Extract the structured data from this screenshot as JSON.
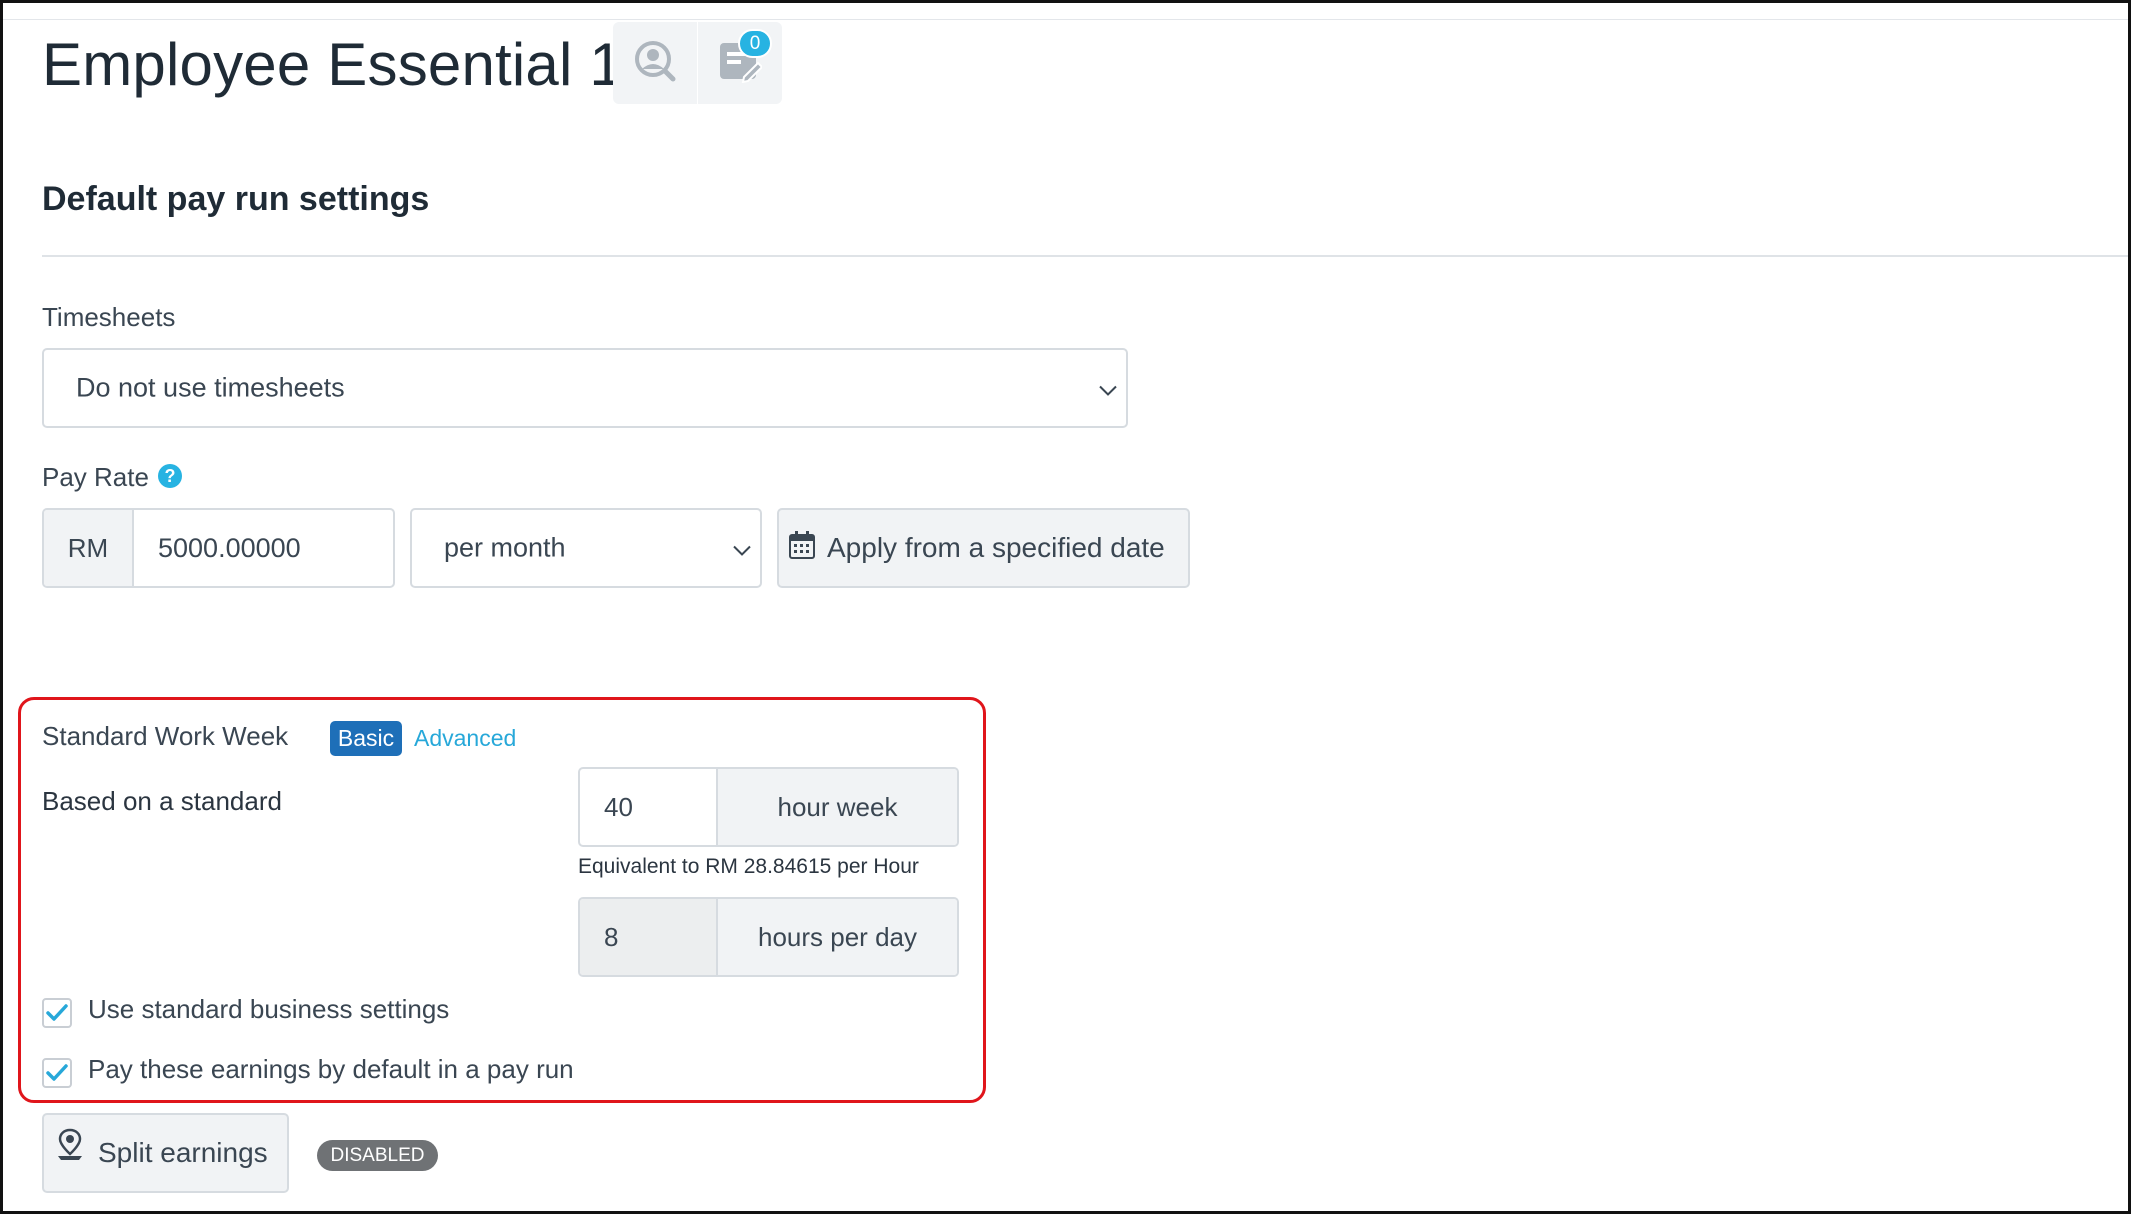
{
  "header": {
    "title": "Employee Essential 1",
    "notes_count": "0",
    "icons": [
      "user-search-icon",
      "notes-icon"
    ]
  },
  "section": {
    "title": "Default pay run settings"
  },
  "timesheets": {
    "label": "Timesheets",
    "selected": "Do not use timesheets"
  },
  "pay_rate": {
    "label": "Pay Rate",
    "help": "?",
    "currency": "RM",
    "amount": "5000.00000",
    "period": "per month",
    "apply_label": "Apply from a specified date"
  },
  "work_week": {
    "title": "Standard Work Week",
    "basic_label": "Basic",
    "advanced_label": "Advanced",
    "based_label": "Based on a standard",
    "hours_week_value": "40",
    "hours_week_unit": "hour week",
    "equivalent": "Equivalent to RM 28.84615 per Hour",
    "hours_day_value": "8",
    "hours_day_unit": "hours per day",
    "use_standard_label": "Use standard business settings",
    "use_standard_checked": true,
    "pay_default_label": "Pay these earnings by default in a pay run",
    "pay_default_checked": true
  },
  "split": {
    "label": "Split earnings",
    "status": "DISABLED"
  },
  "colors": {
    "accent": "#27b3e2",
    "basic_pill": "#1e6fb8",
    "highlight_border": "#e0151b",
    "disabled_badge": "#6f7275"
  }
}
